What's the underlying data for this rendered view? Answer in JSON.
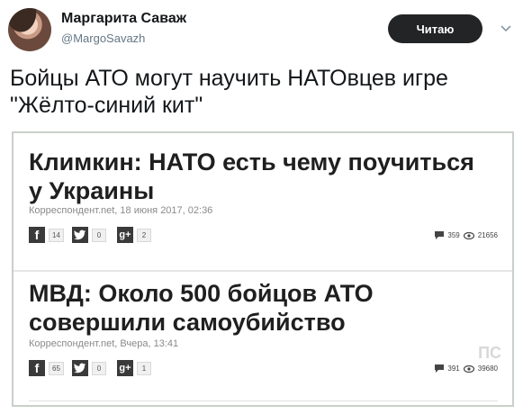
{
  "header": {
    "display_name": "Маргарита Саваж",
    "handle": "@MargoSavazh",
    "follow_label": "Читаю"
  },
  "tweet": {
    "text_line1": "Бойцы АТО могут научить НАТОвцев игре",
    "text_line2": "\"Жёлто-синий кит\""
  },
  "cards": [
    {
      "headline_line1": "Климкин: НАТО есть чему поучиться",
      "headline_line2": "у Украины",
      "meta": "Корреспондент.net, 18 июня 2017, 02:36",
      "fb_count": "14",
      "tw_count": "0",
      "gplus_count": "2",
      "comments": "359",
      "views": "21656"
    },
    {
      "headline_line1": "МВД: Около 500 бойцов АТО",
      "headline_line2": "совершили самоубийство",
      "meta": "Корреспондент.net, Вчера, 13:41",
      "fb_count": "65",
      "tw_count": "0",
      "gplus_count": "1",
      "comments": "391",
      "views": "39680"
    }
  ],
  "icons": {
    "facebook": "f",
    "twitter": "bird",
    "gplus": "g+"
  },
  "watermark": "ПС"
}
